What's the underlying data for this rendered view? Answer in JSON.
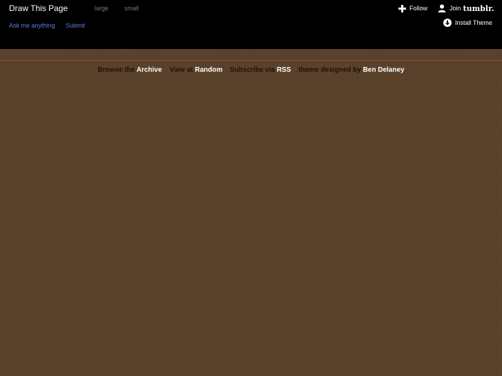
{
  "header": {
    "title": "Draw This Page",
    "size_options": [
      "large",
      "small"
    ],
    "nav": {
      "ask_label": "Ask me anything",
      "submit_label": "Submit"
    }
  },
  "tumblr_controls": {
    "follow_label": "Follow",
    "join_label": "Join",
    "brand": "tumblr.",
    "install_label": "Install Theme"
  },
  "footer_nav": {
    "archive_prefix": "Browse the",
    "archive_link": "Archive",
    "random_prefix": "View at",
    "random_link": "Random",
    "rss_prefix": "Subscribe via",
    "rss_link": "RSS",
    "credit_prefix": "theme designed by",
    "credit_link": "Ben Delaney"
  },
  "colors": {
    "background": "#5b412a",
    "header": "#000000",
    "link_blue": "#5b7fe0",
    "muted_text": "#1c120a"
  },
  "icons": [
    "plus-icon",
    "person-icon",
    "download-circle-icon"
  ]
}
